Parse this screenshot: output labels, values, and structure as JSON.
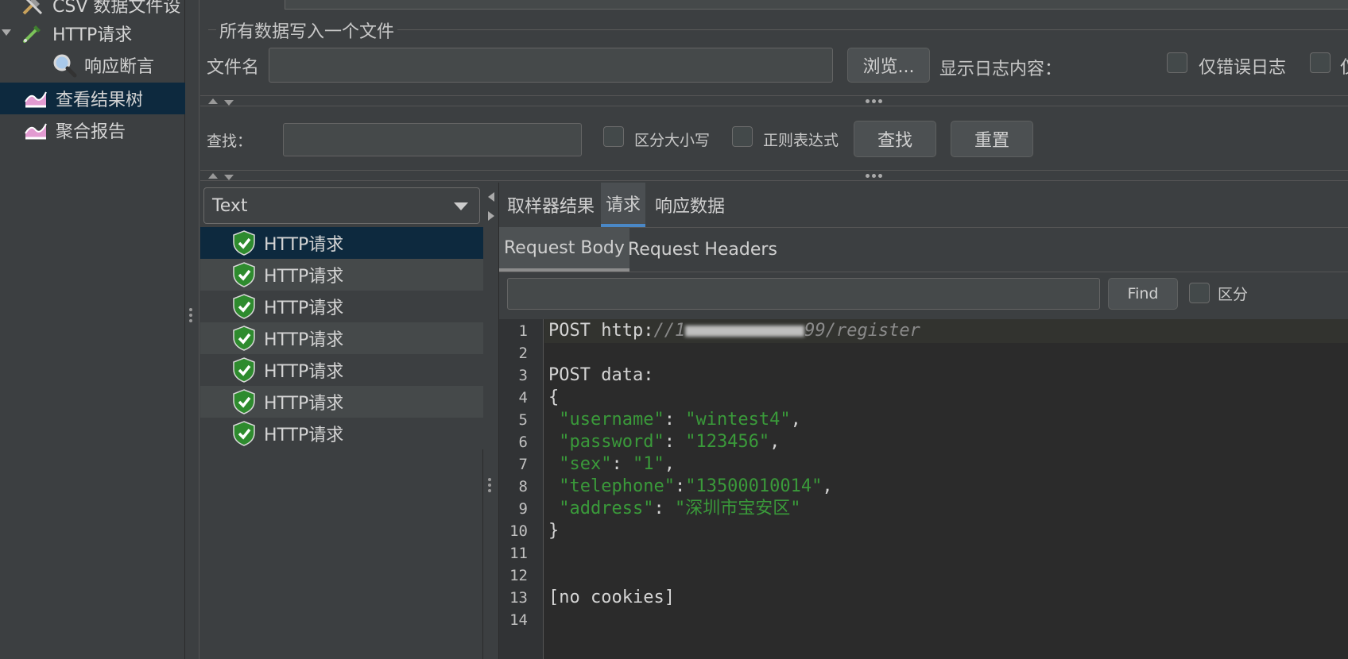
{
  "tree": {
    "items": [
      {
        "label": "CSV 数据文件设",
        "icon": "tools-icon"
      },
      {
        "label": "HTTP请求",
        "icon": "pipette-icon"
      },
      {
        "label": "响应断言",
        "icon": "magnifier-icon"
      },
      {
        "label": "查看结果树",
        "icon": "chart-icon"
      },
      {
        "label": "聚合报告",
        "icon": "chart-icon"
      }
    ]
  },
  "file_group": {
    "title": "所有数据写入一个文件",
    "filename_label": "文件名",
    "filename_value": "",
    "browse_label": "浏览...",
    "show_log_label": "显示日志内容：",
    "errors_only_label": "仅错误日志",
    "successes_only_label": "仅"
  },
  "search": {
    "label": "查找：",
    "value": "",
    "case_label": "区分大小写",
    "regex_label": "正则表达式",
    "find_label": "查找",
    "reset_label": "重置"
  },
  "renderer": {
    "selected": "Text"
  },
  "results": [
    {
      "label": "HTTP请求",
      "status": "success"
    },
    {
      "label": "HTTP请求",
      "status": "success"
    },
    {
      "label": "HTTP请求",
      "status": "success"
    },
    {
      "label": "HTTP请求",
      "status": "success"
    },
    {
      "label": "HTTP请求",
      "status": "success"
    },
    {
      "label": "HTTP请求",
      "status": "success"
    },
    {
      "label": "HTTP请求",
      "status": "success"
    }
  ],
  "detail": {
    "tabs": [
      "取样器结果",
      "请求",
      "响应数据"
    ],
    "active_tab": "请求",
    "subtabs": [
      "Request Body",
      "Request Headers"
    ],
    "active_subtab": "Request Body",
    "find_value": "",
    "find_label": "Find",
    "case_label": "区分"
  },
  "request_body": {
    "line_numbers": [
      "1",
      "2",
      "3",
      "4",
      "5",
      "6",
      "7",
      "8",
      "9",
      "10",
      "11",
      "12",
      "13",
      "14"
    ],
    "method": "POST ",
    "scheme": "http:",
    "url_prefix": "//1",
    "url_suffix": "99/register",
    "post_data_label": "POST data:",
    "open_brace": "{",
    "close_brace": "}",
    "fields": [
      {
        "key": "\"username\"",
        "sep": ": ",
        "value": "\"wintest4\"",
        "end": ","
      },
      {
        "key": "\"password\"",
        "sep": ": ",
        "value": "\"123456\"",
        "end": ","
      },
      {
        "key": "\"sex\"",
        "sep": ": ",
        "value": "\"1\"",
        "end": ","
      },
      {
        "key": "\"telephone\"",
        "sep": ":",
        "value": "\"13500010014\"",
        "end": ","
      },
      {
        "key": "\"address\"",
        "sep": ": ",
        "value": "\"深圳市宝安区\"",
        "end": ""
      }
    ],
    "cookies": "[no cookies]"
  }
}
